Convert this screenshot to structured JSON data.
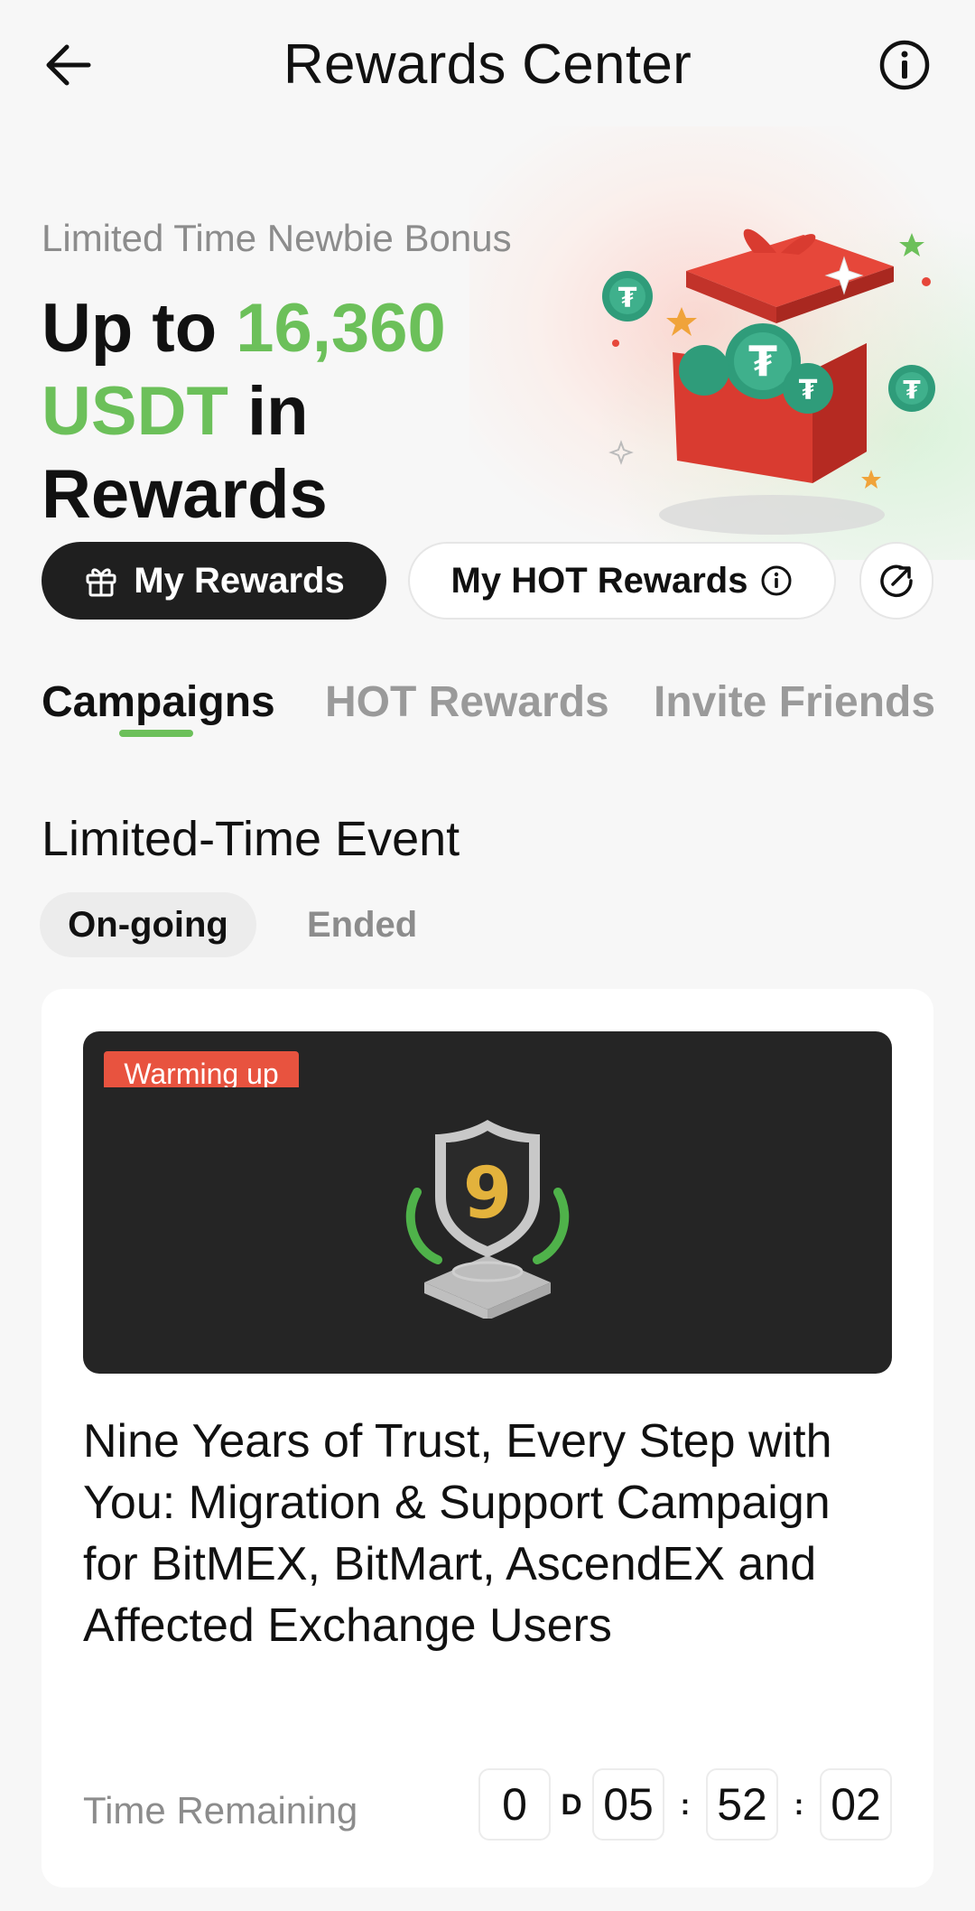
{
  "header": {
    "title": "Rewards Center",
    "back_icon": "arrow-left-icon",
    "info_icon": "info-circle-icon"
  },
  "hero": {
    "subtitle": "Limited Time Newbie Bonus",
    "headline_prefix": "Up to ",
    "headline_amount": "16,360",
    "headline_currency": "USDT",
    "headline_suffix_1": " in",
    "headline_suffix_2": "Rewards",
    "accent_color": "#6cc05a"
  },
  "actions": {
    "my_rewards_label": "My Rewards",
    "my_hot_rewards_label": "My HOT Rewards",
    "share_icon": "share-arrow-icon"
  },
  "tabs": [
    {
      "label": "Campaigns",
      "active": true
    },
    {
      "label": "HOT Rewards",
      "active": false
    },
    {
      "label": "Invite Friends",
      "active": false
    }
  ],
  "section": {
    "title": "Limited-Time Event",
    "filters": [
      {
        "label": "On-going",
        "active": true
      },
      {
        "label": "Ended",
        "active": false
      }
    ]
  },
  "campaign": {
    "badge": "Warming up",
    "badge_color": "#e8533f",
    "trophy_number": "9",
    "title": "Nine Years of Trust, Every Step with You: Migration & Support Campaign for BitMEX, BitMart, AscendEX and Affected Exchange Users",
    "time_label": "Time Remaining",
    "countdown": {
      "days": "0",
      "day_unit": "D",
      "hours": "05",
      "minutes": "52",
      "seconds": "02"
    }
  }
}
